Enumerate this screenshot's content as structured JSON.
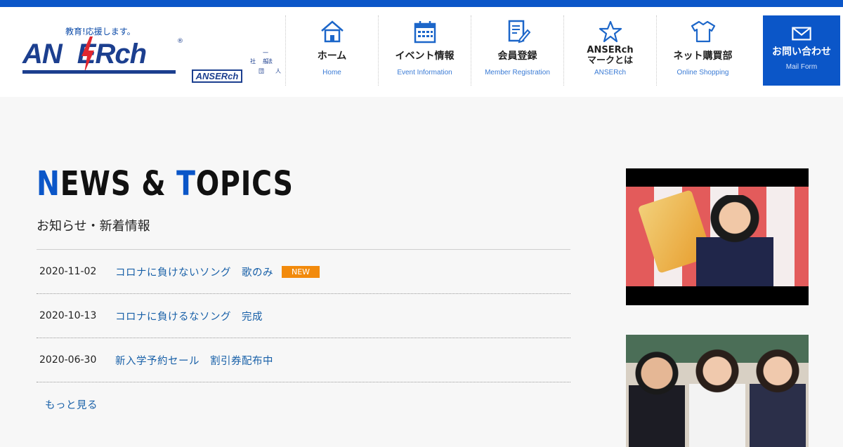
{
  "header": {
    "tagline": "教育!応援します。",
    "brand_left": "AN",
    "brand_right": "ERch",
    "registered": "®",
    "badge": "ANSERch",
    "kanji": [
      "一般",
      "社",
      "団",
      "法",
      "人"
    ]
  },
  "nav": [
    {
      "label": "ホーム",
      "sub": "Home",
      "icon": "home-icon"
    },
    {
      "label": "イベント情報",
      "sub": "Event Information",
      "icon": "calendar-icon"
    },
    {
      "label": "会員登録",
      "sub": "Member Registration",
      "icon": "register-icon"
    },
    {
      "label_line1": "ANSERch",
      "label_line2": "マークとは",
      "sub": "ANSERch",
      "icon": "star-icon"
    },
    {
      "label": "ネット購買部",
      "sub": "Online Shopping",
      "icon": "tshirt-icon"
    },
    {
      "label": "お問い合わせ",
      "sub": "Mail Form",
      "icon": "mail-icon"
    }
  ],
  "news": {
    "title_n": "N",
    "title_ews": "EWS & ",
    "title_t": "T",
    "title_opics": "OPICS",
    "subtitle": "お知らせ・新着情報",
    "items": [
      {
        "date": "2020-11-02",
        "text": "コロナに負けないソング　歌のみ",
        "badge": "NEW"
      },
      {
        "date": "2020-10-13",
        "text": "コロナに負けるなソング　完成"
      },
      {
        "date": "2020-06-30",
        "text": "新入学予約セール　割引券配布中"
      }
    ],
    "more": "もっと見る"
  },
  "colors": {
    "brand_blue": "#0b56c8",
    "link": "#1860a8",
    "new_badge": "#f28a0c"
  }
}
